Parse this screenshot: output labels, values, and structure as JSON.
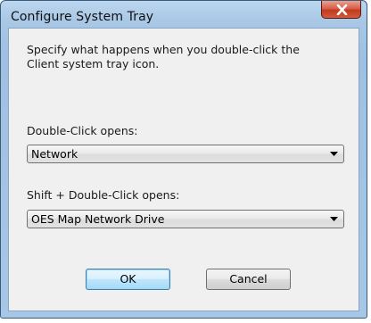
{
  "window": {
    "title": "Configure System Tray"
  },
  "description": {
    "line1": "Specify what happens when you double-click the",
    "line2": "Client system tray icon."
  },
  "double_click": {
    "label": "Double-Click opens:",
    "selected": "Network"
  },
  "shift_double_click": {
    "label": "Shift + Double-Click opens:",
    "selected": "OES Map Network Drive"
  },
  "buttons": {
    "ok": "OK",
    "cancel": "Cancel"
  },
  "icons": {
    "close": "close-icon",
    "dropdown": "chevron-down-icon"
  },
  "colors": {
    "close_button": "#c7432a",
    "default_button_border": "#3c7fb1",
    "window_frame": "#a9c8e6"
  }
}
